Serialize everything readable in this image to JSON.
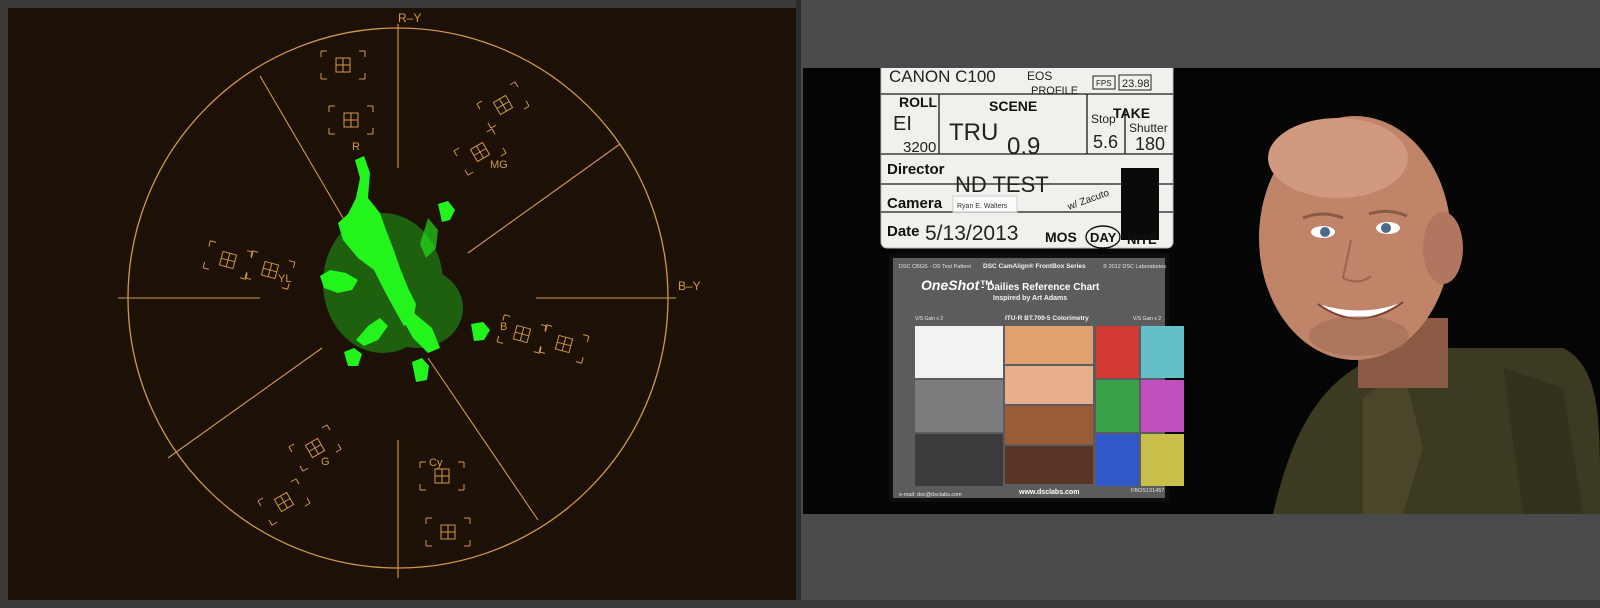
{
  "scope": {
    "labels": {
      "r_minus_y": "R–Y",
      "b_minus_y": "B–Y",
      "r": "R",
      "mg": "MG",
      "b": "B",
      "cy": "Cy",
      "g": "G",
      "yl": "YL"
    },
    "colors": {
      "background": "#1c1007",
      "graticule": "#d19a46",
      "trace": "#23f51c"
    }
  },
  "viewer": {
    "slate": {
      "line1": "CANON C100",
      "line2": "EOS",
      "line3": "PROFILE",
      "fps_label": "FPS",
      "fps_value": "23.98",
      "roll_label": "ROLL",
      "scene_label": "SCENE",
      "take_label": "TAKE",
      "roll_value_1": "EI",
      "roll_value_2": "3200",
      "scene_value_1": "TRU",
      "scene_value_2": "0.9",
      "stop_label": "Stop",
      "shutter_label": "Shutter",
      "stop_value": "5.6",
      "shutter_value": "180",
      "director_label": "Director",
      "director_value": "ND TEST",
      "camera_label": "Camera",
      "camera_value": "Ryan E. Walters",
      "note": "w/ Zacuto",
      "date_label": "Date",
      "date_value": "5/13/2013",
      "mos_label": "MOS",
      "day_label": "DAY",
      "nite_label": "NITE"
    },
    "chart": {
      "top_left": "DSC CBGS - OS Test Pattern",
      "series": "DSC CamAlign® FrontBox Series",
      "copyright": "© 2012 DSC Laboratories",
      "brand": "OneShot™",
      "title": "- Dailies Reference Chart",
      "subtitle": "Inspired by Art Adams",
      "left_gain": "V/S Gain x 2",
      "colorimetry": "ITU-R BT.709-5 Colorimetry",
      "right_gain": "V/S Gain x 2",
      "email": "e-mail: dsc@dsclabs.com",
      "website": "www.dsclabs.com",
      "serial": "FBOS131457",
      "swatches_left": [
        "#f2f2f0",
        "#7c7c7e",
        "#3c3c3e"
      ],
      "swatches_skin": [
        "#e0a070",
        "#e8b08a",
        "#9a5c36",
        "#5a3424"
      ],
      "swatches_primary": [
        "#d03a30",
        "#62c0c8",
        "#3aa04a",
        "#c050c0",
        "#3058c8",
        "#c8c048"
      ]
    }
  }
}
